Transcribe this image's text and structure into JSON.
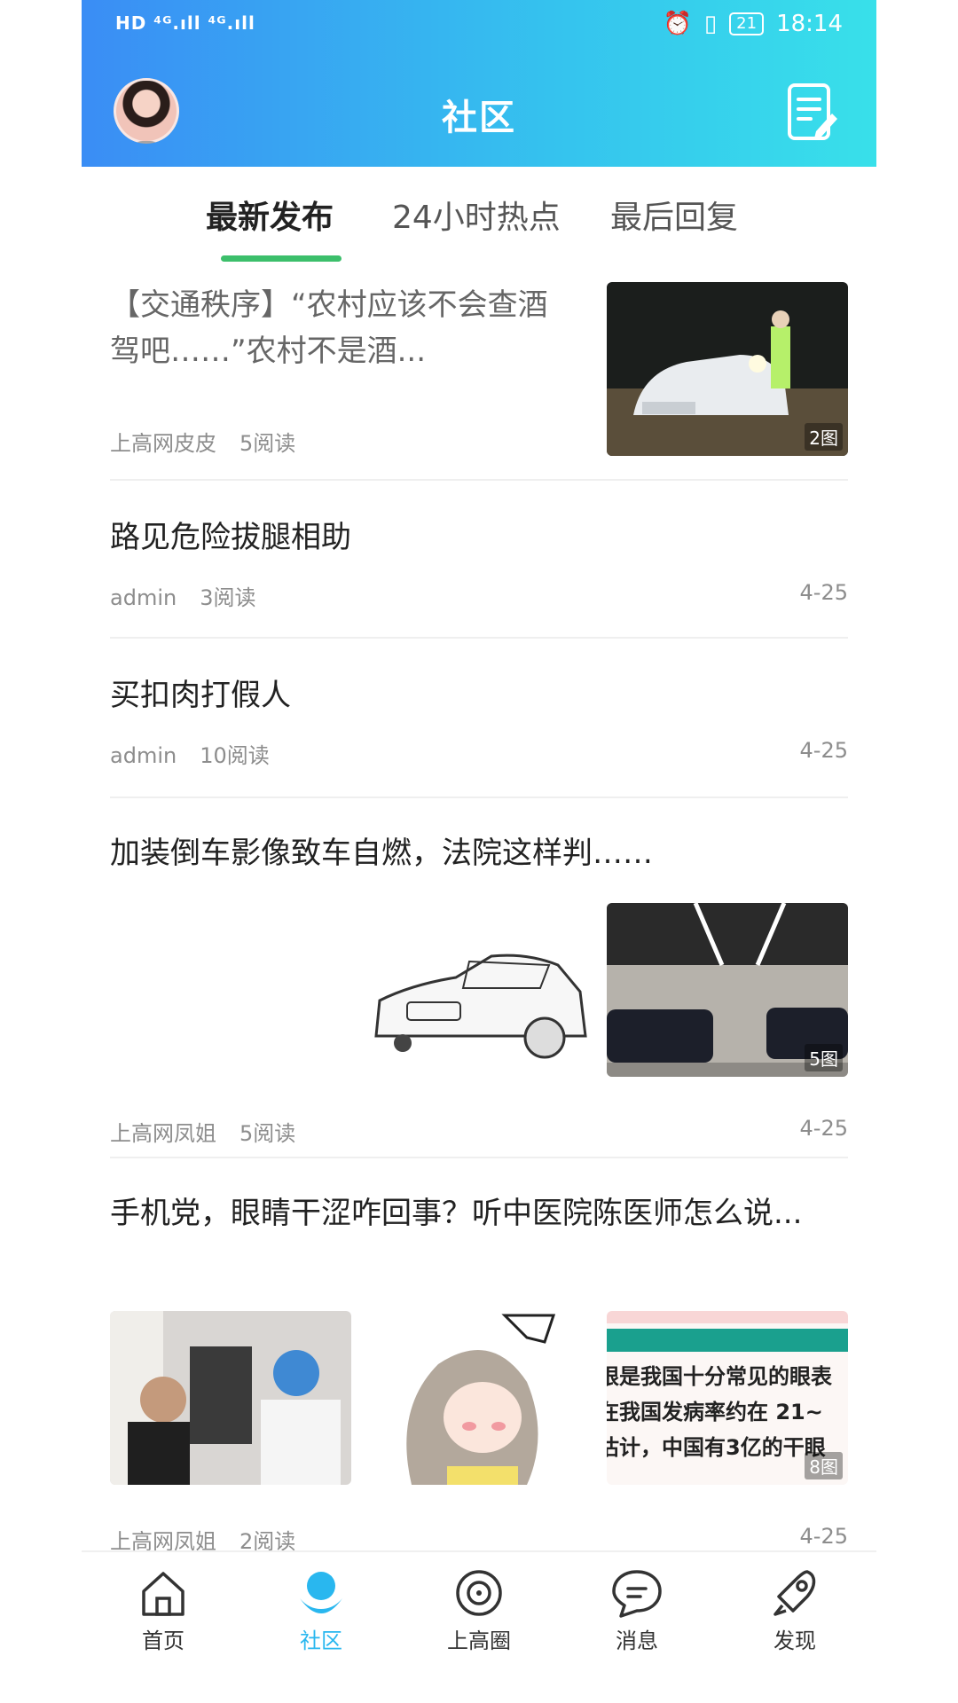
{
  "status_bar": {
    "left_text": "HD ⁴ᴳ.ıll ⁴ᴳ.ıll",
    "battery": "21",
    "time": "18:14"
  },
  "header": {
    "title": "社区"
  },
  "tabs": [
    {
      "label": "最新发布",
      "active": true
    },
    {
      "label": "24小时热点",
      "active": false
    },
    {
      "label": "最后回复",
      "active": false
    }
  ],
  "posts": [
    {
      "title": "【交通秩序】“农村应该不会查酒驾吧……”农村不是酒...",
      "author": "上高网皮皮",
      "reads": "5阅读",
      "date": "",
      "image_count": "2图"
    },
    {
      "title": "路见危险拔腿相助",
      "author": "admin",
      "reads": "3阅读",
      "date": "4-25"
    },
    {
      "title": "买扣肉打假人",
      "author": "admin",
      "reads": "10阅读",
      "date": "4-25"
    },
    {
      "title": "加装倒车影像致车自燃，法院这样判……",
      "author": "上高网凤姐",
      "reads": "5阅读",
      "date": "4-25",
      "image_count": "5图"
    },
    {
      "title": "手机党，眼睛干涩咋回事？听中医院陈医师怎么说...",
      "author": "上高网凤姐",
      "reads": "2阅读",
      "date": "4-25",
      "image_count": "8图",
      "image3_text": [
        "眼是我国十分常见的眼表",
        "在我国发病率约在 21~",
        "估计，中国有3亿的干眼"
      ]
    }
  ],
  "bottom_nav": [
    {
      "label": "首页",
      "icon": "home-icon",
      "active": false
    },
    {
      "label": "社区",
      "icon": "community-icon",
      "active": true
    },
    {
      "label": "上高圈",
      "icon": "circle-icon",
      "active": false
    },
    {
      "label": "消息",
      "icon": "message-icon",
      "active": false
    },
    {
      "label": "发现",
      "icon": "rocket-icon",
      "active": false
    }
  ],
  "colors": {
    "header_start": "#3a8df5",
    "header_end": "#38e0ea",
    "tab_indicator": "#3cbf6b",
    "nav_active": "#29b7ef"
  }
}
